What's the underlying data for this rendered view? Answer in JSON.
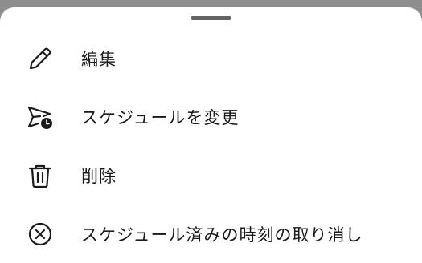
{
  "bottom_sheet": {
    "items": [
      {
        "label": "編集",
        "icon": "pencil-icon"
      },
      {
        "label": "スケジュールを変更",
        "icon": "send-clock-icon"
      },
      {
        "label": "削除",
        "icon": "trash-icon"
      },
      {
        "label": "スケジュール済みの時刻の取り消し",
        "icon": "cancel-circle-icon"
      }
    ]
  },
  "colors": {
    "backdrop": "#8e8e8e",
    "sheet": "#ffffff",
    "handle": "#646464",
    "text": "#1a1a1a"
  }
}
